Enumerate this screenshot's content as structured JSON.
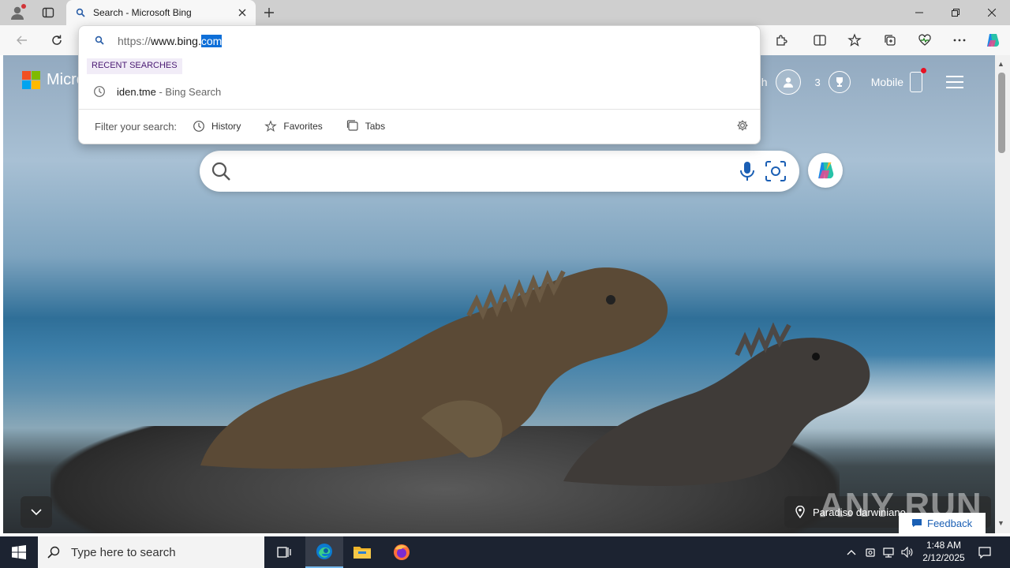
{
  "browser": {
    "tab_title": "Search - Microsoft Bing",
    "colors": {
      "tabstrip": "#cfcfcf",
      "toolbar": "#f7f7f7",
      "selection": "#0e6fd8"
    }
  },
  "omnibox": {
    "url_scheme": "https://",
    "url_main": "www.bing.",
    "url_selected": "com",
    "recent_label": "RECENT SEARCHES",
    "recent_items": [
      {
        "text": "iden.tme",
        "sub": " - Bing Search"
      }
    ],
    "filter_label": "Filter your search:",
    "filters": [
      {
        "label": "History",
        "icon": "history-icon"
      },
      {
        "label": "Favorites",
        "icon": "star-icon"
      },
      {
        "label": "Tabs",
        "icon": "tabs-icon"
      }
    ]
  },
  "page": {
    "logo_text": "Micro",
    "header_partial": "h",
    "rewards_count": "3",
    "mobile_label": "Mobile",
    "location_text": "Paradiso darwiniano",
    "feedback_label": "Feedback",
    "watermark": "ANY RUN"
  },
  "taskbar": {
    "search_placeholder": "Type here to search",
    "time": "1:48 AM",
    "date": "2/12/2025"
  }
}
